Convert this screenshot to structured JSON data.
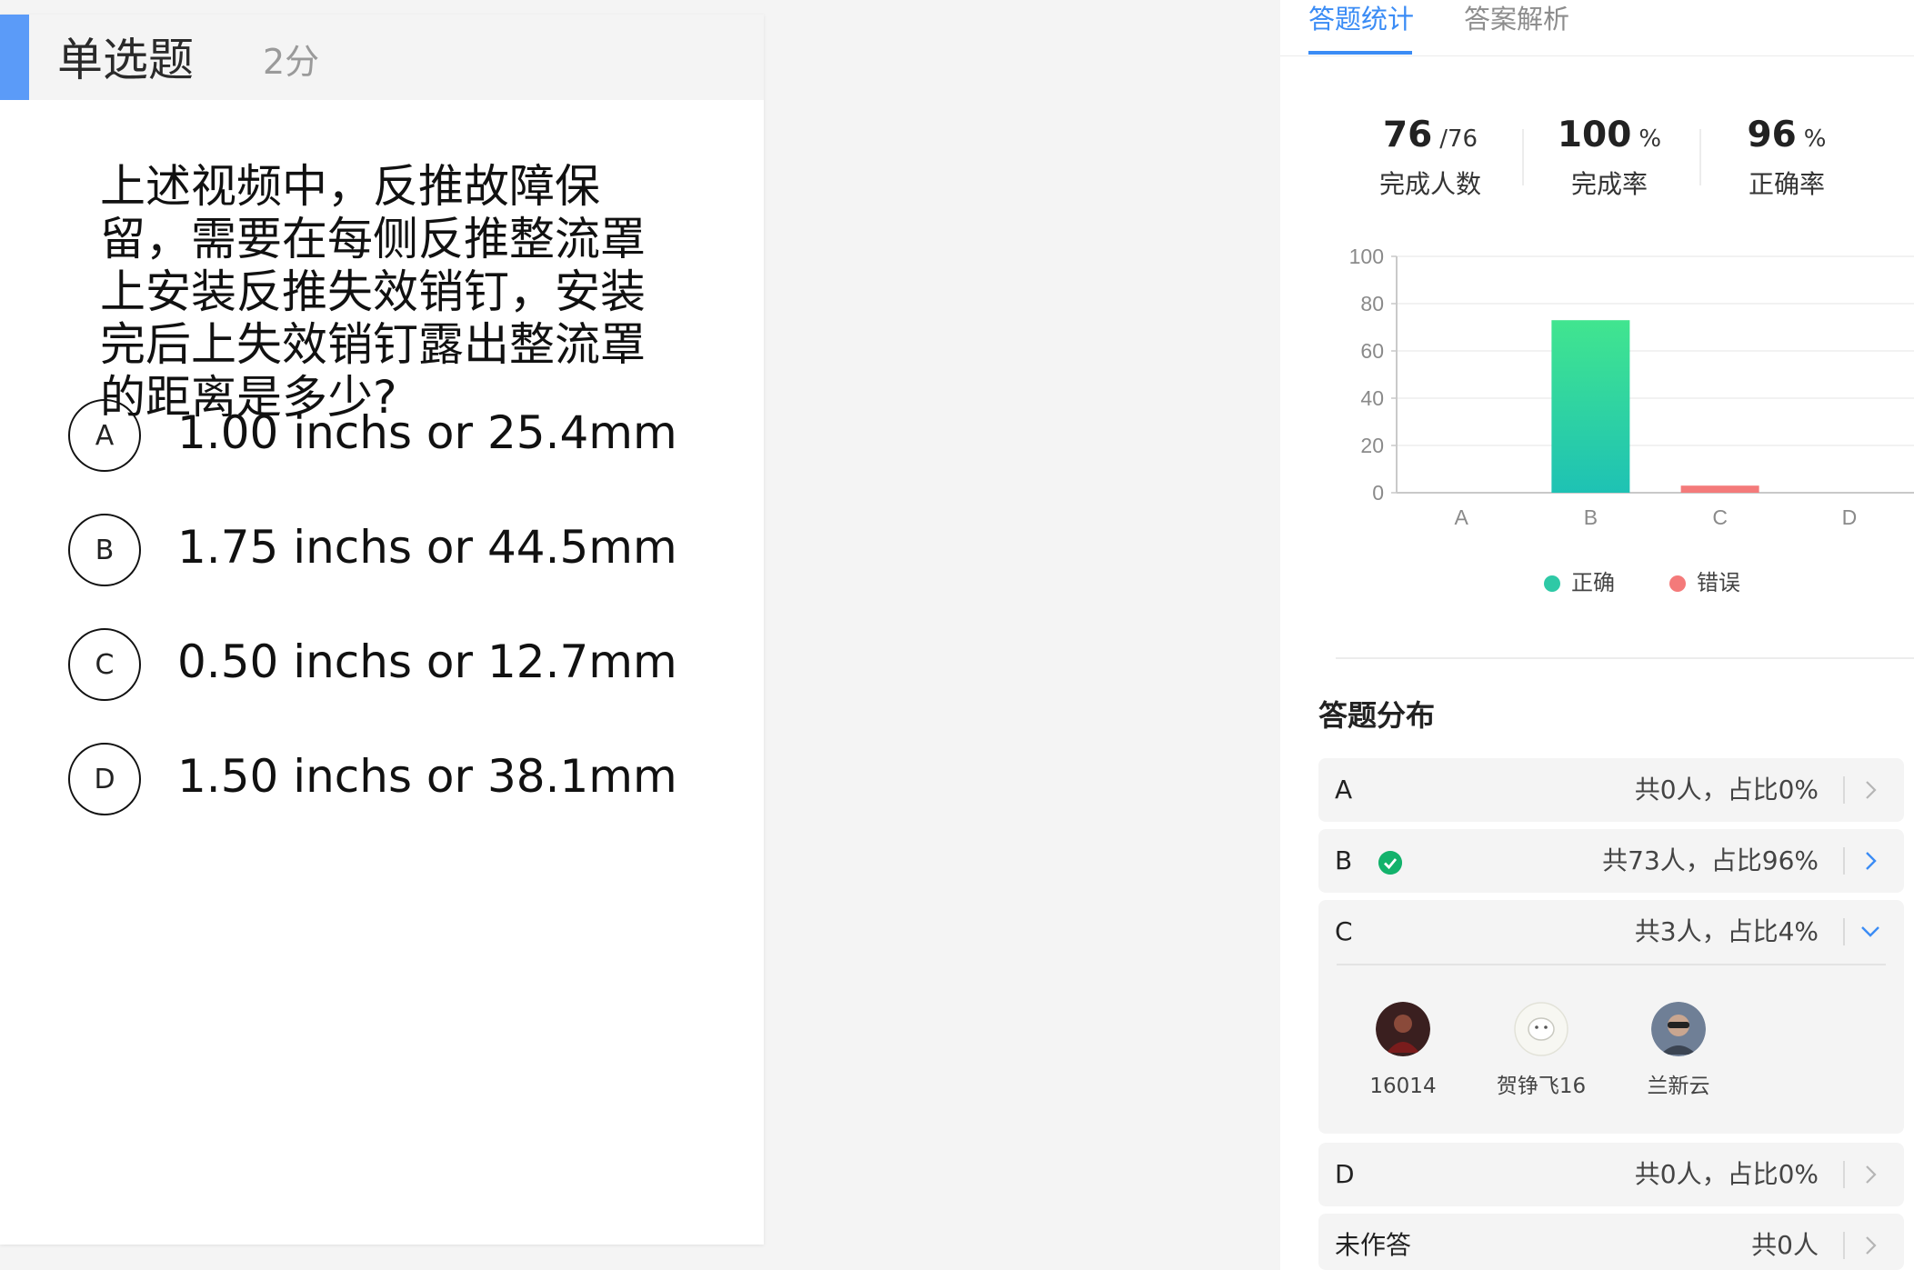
{
  "question": {
    "type": "单选题",
    "score": "2分",
    "stem": "上述视频中，反推故障保留，需要在每侧反推整流罩上安装反推失效销钉，安装完后上失效销钉露出整流罩的距离是多少?",
    "options": [
      {
        "letter": "A",
        "text": "1.00 inchs or 25.4mm"
      },
      {
        "letter": "B",
        "text": "1.75 inchs or 44.5mm"
      },
      {
        "letter": "C",
        "text": "0.50 inchs or 12.7mm"
      },
      {
        "letter": "D",
        "text": "1.50 inchs or 38.1mm"
      }
    ]
  },
  "tabs": [
    "答题统计",
    "答案解析"
  ],
  "stats": [
    {
      "value": "76",
      "unit": "/76",
      "label": "完成人数"
    },
    {
      "value": "100",
      "unit": "%",
      "label": "完成率"
    },
    {
      "value": "96",
      "unit": "%",
      "label": "正确率"
    }
  ],
  "colors": {
    "accent": "#3b8cf5",
    "correct": "#2ec9a6",
    "wrong": "#f47a7a",
    "check": "#12b26b"
  },
  "chart_data": {
    "type": "bar",
    "categories": [
      "A",
      "B",
      "C",
      "D"
    ],
    "ylim": [
      0,
      100
    ],
    "yticks": [
      0,
      20,
      40,
      60,
      80,
      100
    ],
    "series": [
      {
        "name": "正确",
        "values": [
          0,
          73,
          0,
          0
        ],
        "color": "#2ec9a6"
      },
      {
        "name": "错误",
        "values": [
          0,
          0,
          3,
          0
        ],
        "color": "#f47a7a"
      }
    ],
    "legend": "bottom"
  },
  "legend": [
    "正确",
    "错误"
  ],
  "distribution": {
    "title": "答题分布",
    "rows": [
      {
        "letter": "A",
        "stat": "共0人，占比0%"
      },
      {
        "letter": "B",
        "stat": "共73人，占比96%"
      },
      {
        "letter": "C",
        "stat": "共3人，占比4%"
      },
      {
        "letter": "D",
        "stat": "共0人，占比0%"
      },
      {
        "letter": "未作答",
        "stat": "共0人"
      }
    ],
    "c_students": [
      "16014",
      "贺铮飞16",
      "兰新云"
    ]
  }
}
